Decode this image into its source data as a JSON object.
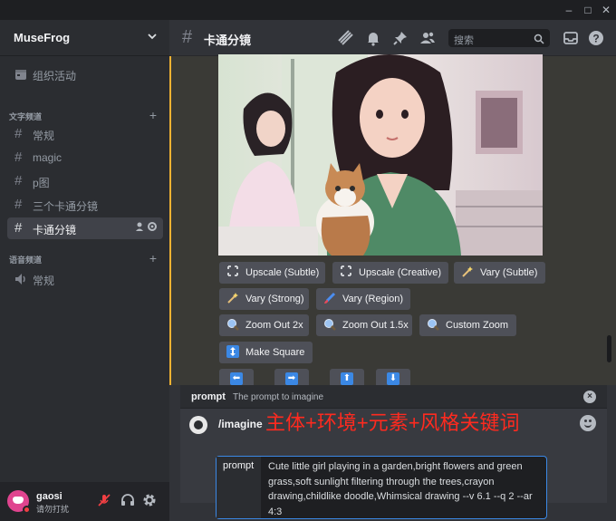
{
  "window": {
    "minimize": "–",
    "maximize": "□",
    "close": "✕"
  },
  "server": {
    "name": "MuseFrog"
  },
  "sidebar": {
    "events": "组织活动",
    "text_category": "文字频道",
    "voice_category": "语音频道",
    "text_channels": [
      {
        "label": "常规"
      },
      {
        "label": "magic"
      },
      {
        "label": "p图"
      },
      {
        "label": "三个卡通分镜"
      },
      {
        "label": "卡通分镜"
      }
    ],
    "voice_channels": [
      {
        "label": "常规"
      }
    ]
  },
  "user": {
    "name": "gaosi",
    "status": "请勿打扰"
  },
  "channel": {
    "title": "卡通分镜"
  },
  "search": {
    "placeholder": "搜索"
  },
  "buttons": [
    {
      "label": "Upscale (Subtle)",
      "icon": "upscale-icon"
    },
    {
      "label": "Upscale (Creative)",
      "icon": "upscale-icon"
    },
    {
      "label": "Vary (Subtle)",
      "icon": "sparkle-icon"
    },
    {
      "label": "Vary (Strong)",
      "icon": "sparkle-icon"
    },
    {
      "label": "Vary (Region)",
      "icon": "brush-icon"
    },
    {
      "label": "Zoom Out 2x",
      "icon": "magnifier-icon"
    },
    {
      "label": "Zoom Out 1.5x",
      "icon": "magnifier-icon"
    },
    {
      "label": "Custom Zoom",
      "icon": "magnifier-icon"
    },
    {
      "label": "Make Square",
      "icon": "arrows-vertical-icon"
    }
  ],
  "pan_arrows": [
    "⬅",
    "➡",
    "⬆",
    "⬇"
  ],
  "command": {
    "option_name": "prompt",
    "option_desc": "The prompt to imagine",
    "name": "/imagine",
    "annotation": "主体+环境+元素+风格关键词",
    "field_label": "prompt",
    "field_value": "Cute little girl playing in a garden,bright flowers and green grass,soft sunlight filtering through the trees,crayon drawing,childlike doodle,Whimsical drawing --v 6.1 --q 2 --ar 4:3"
  },
  "colors": {
    "accent": "#3b88e5",
    "highlight": "#f0b232",
    "annotation": "#ff2a1f",
    "dnd": "#f23f43"
  }
}
